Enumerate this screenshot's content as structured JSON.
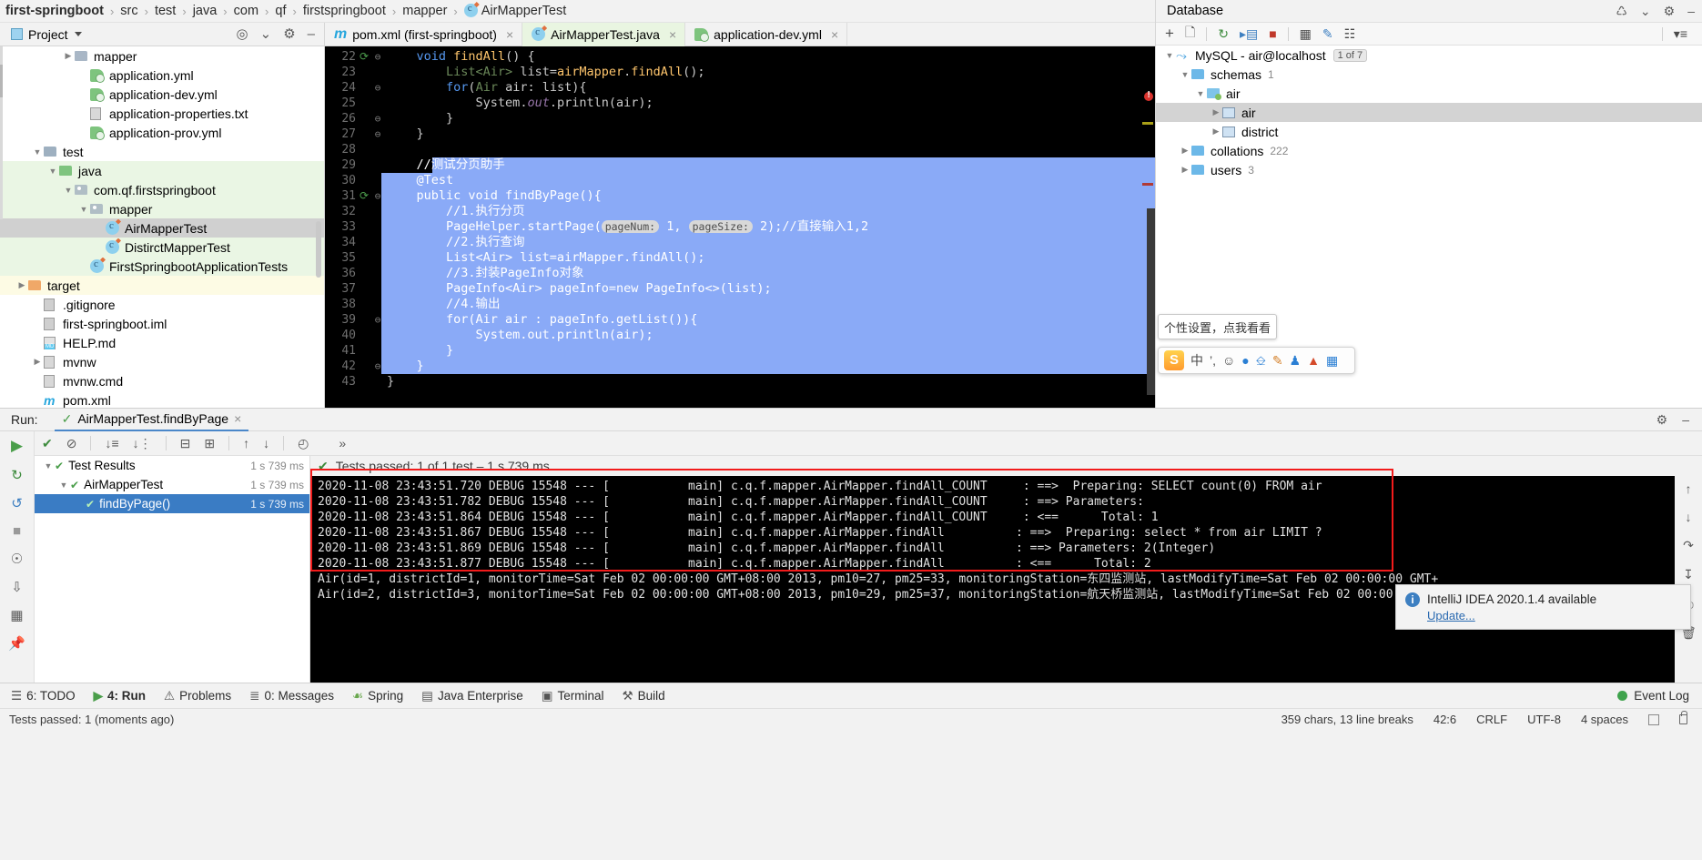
{
  "breadcrumb": {
    "items": [
      {
        "label": "first-springboot",
        "bold": true,
        "icon": ""
      },
      {
        "label": "src",
        "bold": false,
        "icon": ""
      },
      {
        "label": "test",
        "bold": false,
        "icon": ""
      },
      {
        "label": "java",
        "bold": false,
        "icon": ""
      },
      {
        "label": "com",
        "bold": false,
        "icon": ""
      },
      {
        "label": "qf",
        "bold": false,
        "icon": ""
      },
      {
        "label": "firstspringboot",
        "bold": false,
        "icon": ""
      },
      {
        "label": "mapper",
        "bold": false,
        "icon": ""
      },
      {
        "label": "AirMapperTest",
        "bold": false,
        "icon": "class-icon"
      }
    ],
    "separator": "›"
  },
  "project_toolbar": {
    "title": "Project",
    "icons": [
      "locate-icon",
      "collapse-all-icon",
      "settings-gear-icon",
      "hide-icon"
    ]
  },
  "editor_tabs": [
    {
      "label": "pom.xml (first-springboot)",
      "icon": "maven-icon",
      "active": false,
      "close": "×"
    },
    {
      "label": "AirMapperTest.java",
      "icon": "class-icon",
      "active": true,
      "close": "×"
    },
    {
      "label": "application-dev.yml",
      "icon": "yaml-icon",
      "active": false,
      "close": "×"
    }
  ],
  "project_tree": [
    {
      "indent": 4,
      "arrow": "▶",
      "icon": "folder-icon",
      "label": "mapper",
      "bg": "white"
    },
    {
      "indent": 5,
      "arrow": "",
      "icon": "yaml-icon",
      "label": "application.yml",
      "bg": "white"
    },
    {
      "indent": 5,
      "arrow": "",
      "icon": "yaml-icon",
      "label": "application-dev.yml",
      "bg": "white"
    },
    {
      "indent": 5,
      "arrow": "",
      "icon": "txt-icon",
      "label": "application-properties.txt",
      "bg": "white"
    },
    {
      "indent": 5,
      "arrow": "",
      "icon": "yaml-icon",
      "label": "application-prov.yml",
      "bg": "white"
    },
    {
      "indent": 2,
      "arrow": "▼",
      "icon": "folder-test-icon",
      "label": "test",
      "bg": "white"
    },
    {
      "indent": 3,
      "arrow": "▼",
      "icon": "folder-src-icon",
      "label": "java",
      "bg": "green"
    },
    {
      "indent": 4,
      "arrow": "▼",
      "icon": "package-icon",
      "label": "com.qf.firstspringboot",
      "bg": "green"
    },
    {
      "indent": 5,
      "arrow": "▼",
      "icon": "package-icon",
      "label": "mapper",
      "bg": "green"
    },
    {
      "indent": 6,
      "arrow": "",
      "icon": "class-icon",
      "label": "AirMapperTest",
      "bg": "sel"
    },
    {
      "indent": 6,
      "arrow": "",
      "icon": "class-icon",
      "label": "DistirctMapperTest",
      "bg": "green"
    },
    {
      "indent": 5,
      "arrow": "",
      "icon": "class-icon",
      "label": "FirstSpringbootApplicationTests",
      "bg": "green"
    },
    {
      "indent": 1,
      "arrow": "▶",
      "icon": "folder-target-icon",
      "label": "target",
      "bg": "yellow"
    },
    {
      "indent": 2,
      "arrow": "",
      "icon": "gitignore-icon",
      "label": ".gitignore",
      "bg": "white"
    },
    {
      "indent": 2,
      "arrow": "",
      "icon": "iml-icon",
      "label": "first-springboot.iml",
      "bg": "white"
    },
    {
      "indent": 2,
      "arrow": "",
      "icon": "markdown-icon",
      "label": "HELP.md",
      "bg": "white"
    },
    {
      "indent": 2,
      "arrow": "▶",
      "icon": "file-icon",
      "label": "mvnw",
      "bg": "white"
    },
    {
      "indent": 2,
      "arrow": "",
      "icon": "file-icon",
      "label": "mvnw.cmd",
      "bg": "white"
    },
    {
      "indent": 2,
      "arrow": "",
      "icon": "maven-icon",
      "label": "pom.xml",
      "bg": "white"
    }
  ],
  "editor": {
    "first_line_number": 22,
    "lines": [
      {
        "n": 22,
        "gutter": "run-test-icon",
        "fold": "⊖",
        "selected": false,
        "tokens": [
          {
            "t": "    ",
            "c": ""
          },
          {
            "t": "void ",
            "c": "kw2"
          },
          {
            "t": "findAll",
            "c": "mth"
          },
          {
            "t": "() {",
            "c": "id"
          }
        ]
      },
      {
        "n": 23,
        "gutter": "",
        "fold": "",
        "selected": false,
        "tokens": [
          {
            "t": "        ",
            "c": ""
          },
          {
            "t": "List<Air>",
            "c": "grn"
          },
          {
            "t": " list=",
            "c": "id"
          },
          {
            "t": "airMapper",
            "c": "mth"
          },
          {
            "t": ".",
            "c": "id"
          },
          {
            "t": "findAll",
            "c": "mth"
          },
          {
            "t": "();",
            "c": "id"
          }
        ]
      },
      {
        "n": 24,
        "gutter": "",
        "fold": "⊖",
        "selected": false,
        "tokens": [
          {
            "t": "        ",
            "c": ""
          },
          {
            "t": "for",
            "c": "kw2"
          },
          {
            "t": "(",
            "c": "id"
          },
          {
            "t": "Air",
            "c": "grn"
          },
          {
            "t": " air: list){",
            "c": "id"
          }
        ]
      },
      {
        "n": 25,
        "gutter": "",
        "fold": "",
        "selected": false,
        "tokens": [
          {
            "t": "            ",
            "c": ""
          },
          {
            "t": "System",
            "c": "id"
          },
          {
            "t": ".",
            "c": "id"
          },
          {
            "t": "out",
            "c": "fld"
          },
          {
            "t": ".println(air);",
            "c": "id"
          }
        ]
      },
      {
        "n": 26,
        "gutter": "",
        "fold": "⊖",
        "selected": false,
        "tokens": [
          {
            "t": "        }",
            "c": "id"
          }
        ]
      },
      {
        "n": 27,
        "gutter": "",
        "fold": "⊖",
        "selected": false,
        "tokens": [
          {
            "t": "    }",
            "c": "id"
          }
        ]
      },
      {
        "n": 28,
        "gutter": "",
        "fold": "",
        "selected": false,
        "tokens": []
      },
      {
        "n": 29,
        "gutter": "",
        "fold": "",
        "selected": true,
        "tokens": [
          {
            "t": "    //测试分页助手",
            "c": "white"
          }
        ]
      },
      {
        "n": 30,
        "gutter": "",
        "fold": "",
        "selected": true,
        "tokens": [
          {
            "t": "    @Test",
            "c": "white"
          }
        ]
      },
      {
        "n": 31,
        "gutter": "run-test-icon",
        "fold": "⊖",
        "selected": true,
        "tokens": [
          {
            "t": "    public void findByPage(){",
            "c": "white"
          }
        ]
      },
      {
        "n": 32,
        "gutter": "",
        "fold": "",
        "selected": true,
        "tokens": [
          {
            "t": "        //1.执行分页",
            "c": "white"
          }
        ]
      },
      {
        "n": 33,
        "gutter": "",
        "fold": "",
        "selected": true,
        "tokens": [
          {
            "t": "        PageHelper.startPage(",
            "c": "white"
          },
          {
            "t": "pageNum:",
            "c": "hint"
          },
          {
            "t": " 1, ",
            "c": "white"
          },
          {
            "t": "pageSize:",
            "c": "hint"
          },
          {
            "t": " 2);//直接输入1,2",
            "c": "white"
          }
        ]
      },
      {
        "n": 34,
        "gutter": "",
        "fold": "",
        "selected": true,
        "tokens": [
          {
            "t": "        //2.执行查询",
            "c": "white"
          }
        ]
      },
      {
        "n": 35,
        "gutter": "",
        "fold": "",
        "selected": true,
        "tokens": [
          {
            "t": "        List<Air> list=airMapper.findAll();",
            "c": "white"
          }
        ]
      },
      {
        "n": 36,
        "gutter": "",
        "fold": "",
        "selected": true,
        "tokens": [
          {
            "t": "        //3.封装PageInfo对象",
            "c": "white"
          }
        ]
      },
      {
        "n": 37,
        "gutter": "",
        "fold": "",
        "selected": true,
        "tokens": [
          {
            "t": "        PageInfo<Air> pageInfo=new PageInfo<>(list);",
            "c": "white"
          }
        ]
      },
      {
        "n": 38,
        "gutter": "",
        "fold": "",
        "selected": true,
        "tokens": [
          {
            "t": "        //4.输出",
            "c": "white"
          }
        ]
      },
      {
        "n": 39,
        "gutter": "",
        "fold": "⊖",
        "selected": true,
        "tokens": [
          {
            "t": "        for(Air air : pageInfo.getList()){",
            "c": "white"
          }
        ]
      },
      {
        "n": 40,
        "gutter": "",
        "fold": "",
        "selected": true,
        "tokens": [
          {
            "t": "            System.out.println(air);",
            "c": "white"
          }
        ]
      },
      {
        "n": 41,
        "gutter": "",
        "fold": "",
        "selected": true,
        "tokens": [
          {
            "t": "        }",
            "c": "white"
          }
        ]
      },
      {
        "n": 42,
        "gutter": "",
        "fold": "⊖",
        "selected": true,
        "tokens": [
          {
            "t": "    }",
            "c": "white"
          }
        ]
      },
      {
        "n": 43,
        "gutter": "",
        "fold": "",
        "selected": false,
        "tokens": [
          {
            "t": "}",
            "c": "id"
          }
        ]
      }
    ]
  },
  "database": {
    "title": "Database",
    "title_icons": [
      "sync-icon",
      "collapse-icon",
      "settings-gear-icon",
      "hide-icon"
    ],
    "toolbar_icons": [
      "add-icon",
      "copy-icon",
      "refresh-icon",
      "run-sql-icon",
      "stop-icon",
      "table-icon",
      "edit-icon",
      "console-icon",
      "filter-icon"
    ],
    "tree": [
      {
        "indent": 0,
        "arrow": "▼",
        "icon": "mysql-dolphin-icon",
        "label": "MySQL - air@localhost",
        "badge": "1 of 7",
        "count": ""
      },
      {
        "indent": 1,
        "arrow": "▼",
        "icon": "schemas-folder-icon",
        "label": "schemas",
        "badge": "",
        "count": "1"
      },
      {
        "indent": 2,
        "arrow": "▼",
        "icon": "schema-icon",
        "label": "air",
        "badge": "",
        "count": ""
      },
      {
        "indent": 3,
        "arrow": "▶",
        "icon": "table-icon",
        "label": "air",
        "badge": "",
        "count": "",
        "selected": true
      },
      {
        "indent": 3,
        "arrow": "▶",
        "icon": "table-icon",
        "label": "district",
        "badge": "",
        "count": ""
      },
      {
        "indent": 1,
        "arrow": "▶",
        "icon": "collations-folder-icon",
        "label": "collations",
        "badge": "",
        "count": "222"
      },
      {
        "indent": 1,
        "arrow": "▶",
        "icon": "users-folder-icon",
        "label": "users",
        "badge": "",
        "count": "3"
      }
    ]
  },
  "ime": {
    "tooltip": "个性设置，点我看看",
    "logo": "S",
    "items": [
      "中",
      "’,",
      "☺",
      "🎙",
      "⌨",
      "✎",
      "👤",
      "👕",
      "▦"
    ]
  },
  "run_panel": {
    "label": "Run:",
    "tab": "AirMapperTest.findByPage",
    "tab_close": "×",
    "header_icons": [
      "settings-gear-icon",
      "hide-icon"
    ],
    "side_icons": [
      "run-icon",
      "rerun-icon",
      "rerun-failed-icon",
      "stop-icon",
      "screenshot-icon",
      "dump-icon",
      "grid-icon",
      "pin-icon"
    ],
    "toolbar_icons": [
      "check-icon",
      "ignore-icon",
      "sort-alpha-icon",
      "sort-duration-icon",
      "expand-all-icon",
      "collapse-all-icon",
      "prev-icon",
      "next-icon",
      "history-icon",
      "more-icon"
    ],
    "status_text": "Tests passed: 1 of 1 test – 1 s 739 ms",
    "status_check": "✔",
    "tree": [
      {
        "indent": 0,
        "arrow": "▼",
        "label": "Test Results",
        "time": "1 s 739 ms",
        "selected": false
      },
      {
        "indent": 1,
        "arrow": "▼",
        "label": "AirMapperTest",
        "time": "1 s 739 ms",
        "selected": false
      },
      {
        "indent": 2,
        "arrow": "",
        "label": "findByPage()",
        "time": "1 s 739 ms",
        "selected": true
      }
    ],
    "console_lines": [
      "2020-11-08 23:43:51.720 DEBUG 15548 --- [           main] c.q.f.mapper.AirMapper.findAll_COUNT     : ==>  Preparing: SELECT count(0) FROM air",
      "2020-11-08 23:43:51.782 DEBUG 15548 --- [           main] c.q.f.mapper.AirMapper.findAll_COUNT     : ==> Parameters:",
      "2020-11-08 23:43:51.864 DEBUG 15548 --- [           main] c.q.f.mapper.AirMapper.findAll_COUNT     : <==      Total: 1",
      "2020-11-08 23:43:51.867 DEBUG 15548 --- [           main] c.q.f.mapper.AirMapper.findAll          : ==>  Preparing: select * from air LIMIT ?",
      "2020-11-08 23:43:51.869 DEBUG 15548 --- [           main] c.q.f.mapper.AirMapper.findAll          : ==> Parameters: 2(Integer)",
      "2020-11-08 23:43:51.877 DEBUG 15548 --- [           main] c.q.f.mapper.AirMapper.findAll          : <==      Total: 2",
      "Air(id=1, districtId=1, monitorTime=Sat Feb 02 00:00:00 GMT+08:00 2013, pm10=27, pm25=33, monitoringStation=东四监测站, lastModifyTime=Sat Feb 02 00:00:00 GMT+",
      "Air(id=2, districtId=3, monitorTime=Sat Feb 02 00:00:00 GMT+08:00 2013, pm10=29, pm25=37, monitoringStation=航天桥监测站, lastModifyTime=Sat Feb 02 00:00:00 GM"
    ],
    "console_side_icons": [
      "scroll-up-icon",
      "scroll-down-icon",
      "soft-wrap-icon",
      "scroll-end-icon",
      "print-icon",
      "trash-icon"
    ]
  },
  "notification": {
    "title": "IntelliJ IDEA 2020.1.4 available",
    "link": "Update..."
  },
  "bottom_bar": {
    "items": [
      {
        "icon": "todo-icon",
        "label": "6: TODO",
        "active": false
      },
      {
        "icon": "run-icon",
        "label": "4: Run",
        "active": true
      },
      {
        "icon": "problems-icon",
        "label": "Problems",
        "active": false
      },
      {
        "icon": "messages-icon",
        "label": "0: Messages",
        "active": false
      },
      {
        "icon": "spring-icon",
        "label": "Spring",
        "active": false
      },
      {
        "icon": "java-enterprise-icon",
        "label": "Java Enterprise",
        "active": false
      },
      {
        "icon": "terminal-icon",
        "label": "Terminal",
        "active": false
      },
      {
        "icon": "build-icon",
        "label": "Build",
        "active": false
      }
    ],
    "event_log": "Event Log"
  },
  "status_bar": {
    "left": "Tests passed: 1 (moments ago)",
    "right": [
      "359 chars, 13 line breaks",
      "42:6",
      "CRLF",
      "UTF-8",
      "4 spaces"
    ]
  },
  "colors": {
    "accent_blue": "#3a7cc4",
    "selection_blue": "#8aaaf7",
    "highlight_red": "#f21b1b",
    "green_pass": "#4a9e4a",
    "tab_active_green": "#e9f5e1"
  }
}
